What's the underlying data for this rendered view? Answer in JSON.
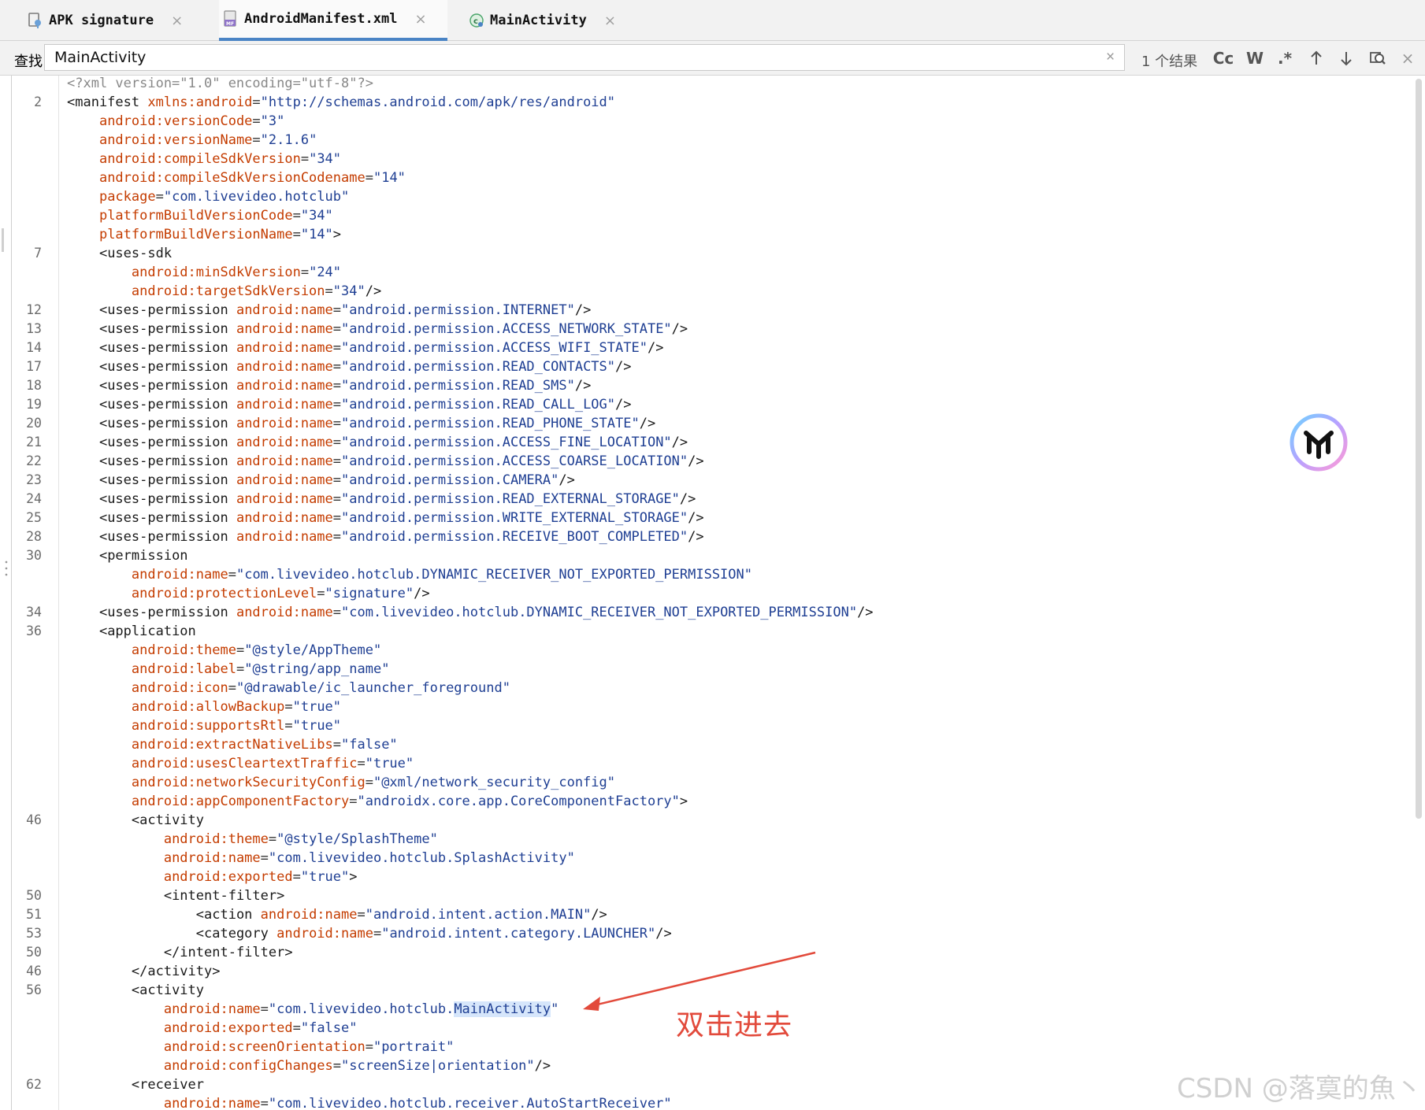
{
  "tabs": [
    {
      "label": "APK signature",
      "icon": "apk-signature-icon"
    },
    {
      "label": "AndroidManifest.xml",
      "icon": "manifest-file-icon",
      "active": true
    },
    {
      "label": "MainActivity",
      "icon": "class-icon"
    }
  ],
  "search": {
    "label": "查找:",
    "value": "MainActivity",
    "result_count": "1 个结果",
    "case_toggle": "Cc",
    "word_toggle": "W",
    "regex_toggle": ".*"
  },
  "line_numbers": [
    {
      "row": 1,
      "n": "2"
    },
    {
      "row": 9,
      "n": "7"
    },
    {
      "row": 12,
      "n": "12"
    },
    {
      "row": 13,
      "n": "13"
    },
    {
      "row": 14,
      "n": "14"
    },
    {
      "row": 15,
      "n": "17"
    },
    {
      "row": 16,
      "n": "18"
    },
    {
      "row": 17,
      "n": "19"
    },
    {
      "row": 18,
      "n": "20"
    },
    {
      "row": 19,
      "n": "21"
    },
    {
      "row": 20,
      "n": "22"
    },
    {
      "row": 21,
      "n": "23"
    },
    {
      "row": 22,
      "n": "24"
    },
    {
      "row": 23,
      "n": "25"
    },
    {
      "row": 24,
      "n": "28"
    },
    {
      "row": 25,
      "n": "30"
    },
    {
      "row": 28,
      "n": "34"
    },
    {
      "row": 29,
      "n": "36"
    },
    {
      "row": 39,
      "n": "46"
    },
    {
      "row": 43,
      "n": "50"
    },
    {
      "row": 44,
      "n": "51"
    },
    {
      "row": 45,
      "n": "53"
    },
    {
      "row": 46,
      "n": "50"
    },
    {
      "row": 47,
      "n": "46"
    },
    {
      "row": 48,
      "n": "56"
    },
    {
      "row": 53,
      "n": "62"
    }
  ],
  "code_lines": [
    [
      [
        "c",
        "<?xml version=\"1.0\" encoding=\"utf-8\"?>"
      ]
    ],
    [
      [
        "t",
        "<manifest "
      ],
      [
        "a",
        "xmlns:android"
      ],
      [
        "p",
        "="
      ],
      [
        "v",
        "\"http://schemas.android.com/apk/res/android\""
      ]
    ],
    [
      [
        "p",
        "    "
      ],
      [
        "a",
        "android:versionCode"
      ],
      [
        "p",
        "="
      ],
      [
        "v",
        "\"3\""
      ]
    ],
    [
      [
        "p",
        "    "
      ],
      [
        "a",
        "android:versionName"
      ],
      [
        "p",
        "="
      ],
      [
        "v",
        "\"2.1.6\""
      ]
    ],
    [
      [
        "p",
        "    "
      ],
      [
        "a",
        "android:compileSdkVersion"
      ],
      [
        "p",
        "="
      ],
      [
        "v",
        "\"34\""
      ]
    ],
    [
      [
        "p",
        "    "
      ],
      [
        "a",
        "android:compileSdkVersionCodename"
      ],
      [
        "p",
        "="
      ],
      [
        "v",
        "\"14\""
      ]
    ],
    [
      [
        "p",
        "    "
      ],
      [
        "a",
        "package"
      ],
      [
        "p",
        "="
      ],
      [
        "v",
        "\"com.livevideo.hotclub\""
      ]
    ],
    [
      [
        "p",
        "    "
      ],
      [
        "a",
        "platformBuildVersionCode"
      ],
      [
        "p",
        "="
      ],
      [
        "v",
        "\"34\""
      ]
    ],
    [
      [
        "p",
        "    "
      ],
      [
        "a",
        "platformBuildVersionName"
      ],
      [
        "p",
        "="
      ],
      [
        "v",
        "\"14\""
      ],
      [
        "t",
        ">"
      ]
    ],
    [
      [
        "p",
        "    "
      ],
      [
        "t",
        "<uses-sdk"
      ]
    ],
    [
      [
        "p",
        "        "
      ],
      [
        "a",
        "android:minSdkVersion"
      ],
      [
        "p",
        "="
      ],
      [
        "v",
        "\"24\""
      ]
    ],
    [
      [
        "p",
        "        "
      ],
      [
        "a",
        "android:targetSdkVersion"
      ],
      [
        "p",
        "="
      ],
      [
        "v",
        "\"34\""
      ],
      [
        "t",
        "/>"
      ]
    ],
    [
      [
        "p",
        "    "
      ],
      [
        "t",
        "<uses-permission "
      ],
      [
        "a",
        "android:name"
      ],
      [
        "p",
        "="
      ],
      [
        "v",
        "\"android.permission.INTERNET\""
      ],
      [
        "t",
        "/>"
      ]
    ],
    [
      [
        "p",
        "    "
      ],
      [
        "t",
        "<uses-permission "
      ],
      [
        "a",
        "android:name"
      ],
      [
        "p",
        "="
      ],
      [
        "v",
        "\"android.permission.ACCESS_NETWORK_STATE\""
      ],
      [
        "t",
        "/>"
      ]
    ],
    [
      [
        "p",
        "    "
      ],
      [
        "t",
        "<uses-permission "
      ],
      [
        "a",
        "android:name"
      ],
      [
        "p",
        "="
      ],
      [
        "v",
        "\"android.permission.ACCESS_WIFI_STATE\""
      ],
      [
        "t",
        "/>"
      ]
    ],
    [
      [
        "p",
        "    "
      ],
      [
        "t",
        "<uses-permission "
      ],
      [
        "a",
        "android:name"
      ],
      [
        "p",
        "="
      ],
      [
        "v",
        "\"android.permission.READ_CONTACTS\""
      ],
      [
        "t",
        "/>"
      ]
    ],
    [
      [
        "p",
        "    "
      ],
      [
        "t",
        "<uses-permission "
      ],
      [
        "a",
        "android:name"
      ],
      [
        "p",
        "="
      ],
      [
        "v",
        "\"android.permission.READ_SMS\""
      ],
      [
        "t",
        "/>"
      ]
    ],
    [
      [
        "p",
        "    "
      ],
      [
        "t",
        "<uses-permission "
      ],
      [
        "a",
        "android:name"
      ],
      [
        "p",
        "="
      ],
      [
        "v",
        "\"android.permission.READ_CALL_LOG\""
      ],
      [
        "t",
        "/>"
      ]
    ],
    [
      [
        "p",
        "    "
      ],
      [
        "t",
        "<uses-permission "
      ],
      [
        "a",
        "android:name"
      ],
      [
        "p",
        "="
      ],
      [
        "v",
        "\"android.permission.READ_PHONE_STATE\""
      ],
      [
        "t",
        "/>"
      ]
    ],
    [
      [
        "p",
        "    "
      ],
      [
        "t",
        "<uses-permission "
      ],
      [
        "a",
        "android:name"
      ],
      [
        "p",
        "="
      ],
      [
        "v",
        "\"android.permission.ACCESS_FINE_LOCATION\""
      ],
      [
        "t",
        "/>"
      ]
    ],
    [
      [
        "p",
        "    "
      ],
      [
        "t",
        "<uses-permission "
      ],
      [
        "a",
        "android:name"
      ],
      [
        "p",
        "="
      ],
      [
        "v",
        "\"android.permission.ACCESS_COARSE_LOCATION\""
      ],
      [
        "t",
        "/>"
      ]
    ],
    [
      [
        "p",
        "    "
      ],
      [
        "t",
        "<uses-permission "
      ],
      [
        "a",
        "android:name"
      ],
      [
        "p",
        "="
      ],
      [
        "v",
        "\"android.permission.CAMERA\""
      ],
      [
        "t",
        "/>"
      ]
    ],
    [
      [
        "p",
        "    "
      ],
      [
        "t",
        "<uses-permission "
      ],
      [
        "a",
        "android:name"
      ],
      [
        "p",
        "="
      ],
      [
        "v",
        "\"android.permission.READ_EXTERNAL_STORAGE\""
      ],
      [
        "t",
        "/>"
      ]
    ],
    [
      [
        "p",
        "    "
      ],
      [
        "t",
        "<uses-permission "
      ],
      [
        "a",
        "android:name"
      ],
      [
        "p",
        "="
      ],
      [
        "v",
        "\"android.permission.WRITE_EXTERNAL_STORAGE\""
      ],
      [
        "t",
        "/>"
      ]
    ],
    [
      [
        "p",
        "    "
      ],
      [
        "t",
        "<uses-permission "
      ],
      [
        "a",
        "android:name"
      ],
      [
        "p",
        "="
      ],
      [
        "v",
        "\"android.permission.RECEIVE_BOOT_COMPLETED\""
      ],
      [
        "t",
        "/>"
      ]
    ],
    [
      [
        "p",
        "    "
      ],
      [
        "t",
        "<permission"
      ]
    ],
    [
      [
        "p",
        "        "
      ],
      [
        "a",
        "android:name"
      ],
      [
        "p",
        "="
      ],
      [
        "v",
        "\"com.livevideo.hotclub.DYNAMIC_RECEIVER_NOT_EXPORTED_PERMISSION\""
      ]
    ],
    [
      [
        "p",
        "        "
      ],
      [
        "a",
        "android:protectionLevel"
      ],
      [
        "p",
        "="
      ],
      [
        "v",
        "\"signature\""
      ],
      [
        "t",
        "/>"
      ]
    ],
    [
      [
        "p",
        "    "
      ],
      [
        "t",
        "<uses-permission "
      ],
      [
        "a",
        "android:name"
      ],
      [
        "p",
        "="
      ],
      [
        "v",
        "\"com.livevideo.hotclub.DYNAMIC_RECEIVER_NOT_EXPORTED_PERMISSION\""
      ],
      [
        "t",
        "/>"
      ]
    ],
    [
      [
        "p",
        "    "
      ],
      [
        "t",
        "<application"
      ]
    ],
    [
      [
        "p",
        "        "
      ],
      [
        "a",
        "android:theme"
      ],
      [
        "p",
        "="
      ],
      [
        "v",
        "\"@style/AppTheme\""
      ]
    ],
    [
      [
        "p",
        "        "
      ],
      [
        "a",
        "android:label"
      ],
      [
        "p",
        "="
      ],
      [
        "v",
        "\"@string/app_name\""
      ]
    ],
    [
      [
        "p",
        "        "
      ],
      [
        "a",
        "android:icon"
      ],
      [
        "p",
        "="
      ],
      [
        "v",
        "\"@drawable/ic_launcher_foreground\""
      ]
    ],
    [
      [
        "p",
        "        "
      ],
      [
        "a",
        "android:allowBackup"
      ],
      [
        "p",
        "="
      ],
      [
        "v",
        "\"true\""
      ]
    ],
    [
      [
        "p",
        "        "
      ],
      [
        "a",
        "android:supportsRtl"
      ],
      [
        "p",
        "="
      ],
      [
        "v",
        "\"true\""
      ]
    ],
    [
      [
        "p",
        "        "
      ],
      [
        "a",
        "android:extractNativeLibs"
      ],
      [
        "p",
        "="
      ],
      [
        "v",
        "\"false\""
      ]
    ],
    [
      [
        "p",
        "        "
      ],
      [
        "a",
        "android:usesCleartextTraffic"
      ],
      [
        "p",
        "="
      ],
      [
        "v",
        "\"true\""
      ]
    ],
    [
      [
        "p",
        "        "
      ],
      [
        "a",
        "android:networkSecurityConfig"
      ],
      [
        "p",
        "="
      ],
      [
        "v",
        "\"@xml/network_security_config\""
      ]
    ],
    [
      [
        "p",
        "        "
      ],
      [
        "a",
        "android:appComponentFactory"
      ],
      [
        "p",
        "="
      ],
      [
        "v",
        "\"androidx.core.app.CoreComponentFactory\""
      ],
      [
        "t",
        ">"
      ]
    ],
    [
      [
        "p",
        "        "
      ],
      [
        "t",
        "<activity"
      ]
    ],
    [
      [
        "p",
        "            "
      ],
      [
        "a",
        "android:theme"
      ],
      [
        "p",
        "="
      ],
      [
        "v",
        "\"@style/SplashTheme\""
      ]
    ],
    [
      [
        "p",
        "            "
      ],
      [
        "a",
        "android:name"
      ],
      [
        "p",
        "="
      ],
      [
        "v",
        "\"com.livevideo.hotclub.SplashActivity\""
      ]
    ],
    [
      [
        "p",
        "            "
      ],
      [
        "a",
        "android:exported"
      ],
      [
        "p",
        "="
      ],
      [
        "v",
        "\"true\""
      ],
      [
        "t",
        ">"
      ]
    ],
    [
      [
        "p",
        "            "
      ],
      [
        "t",
        "<intent-filter>"
      ]
    ],
    [
      [
        "p",
        "                "
      ],
      [
        "t",
        "<action "
      ],
      [
        "a",
        "android:name"
      ],
      [
        "p",
        "="
      ],
      [
        "v",
        "\"android.intent.action.MAIN\""
      ],
      [
        "t",
        "/>"
      ]
    ],
    [
      [
        "p",
        "                "
      ],
      [
        "t",
        "<category "
      ],
      [
        "a",
        "android:name"
      ],
      [
        "p",
        "="
      ],
      [
        "v",
        "\"android.intent.category.LAUNCHER\""
      ],
      [
        "t",
        "/>"
      ]
    ],
    [
      [
        "p",
        "            "
      ],
      [
        "t",
        "</intent-filter>"
      ]
    ],
    [
      [
        "p",
        "        "
      ],
      [
        "t",
        "</activity>"
      ]
    ],
    [
      [
        "p",
        "        "
      ],
      [
        "t",
        "<activity"
      ]
    ],
    [
      [
        "p",
        "            "
      ],
      [
        "a",
        "android:name"
      ],
      [
        "p",
        "="
      ],
      [
        "v",
        "\"com.livevideo.hotclub."
      ],
      [
        "hl",
        "MainActivity"
      ],
      [
        "v",
        "\""
      ]
    ],
    [
      [
        "p",
        "            "
      ],
      [
        "a",
        "android:exported"
      ],
      [
        "p",
        "="
      ],
      [
        "v",
        "\"false\""
      ]
    ],
    [
      [
        "p",
        "            "
      ],
      [
        "a",
        "android:screenOrientation"
      ],
      [
        "p",
        "="
      ],
      [
        "v",
        "\"portrait\""
      ]
    ],
    [
      [
        "p",
        "            "
      ],
      [
        "a",
        "android:configChanges"
      ],
      [
        "p",
        "="
      ],
      [
        "v",
        "\"screenSize|orientation\""
      ],
      [
        "t",
        "/>"
      ]
    ],
    [
      [
        "p",
        "        "
      ],
      [
        "t",
        "<receiver"
      ]
    ],
    [
      [
        "p",
        "            "
      ],
      [
        "a",
        "android:name"
      ],
      [
        "p",
        "="
      ],
      [
        "v",
        "\"com.livevideo.hotclub.receiver.AutoStartReceiver\""
      ]
    ]
  ],
  "annotation": {
    "text": "双击进去",
    "color": "#e24a3b"
  },
  "watermark": "CSDN @落寞的魚丶",
  "colors": {
    "tag": "#1a1a1a",
    "attribute": "#c43c00",
    "value": "#1f3f93",
    "highlight": "#d6e6fb",
    "active_tab": "#4a84c5"
  }
}
